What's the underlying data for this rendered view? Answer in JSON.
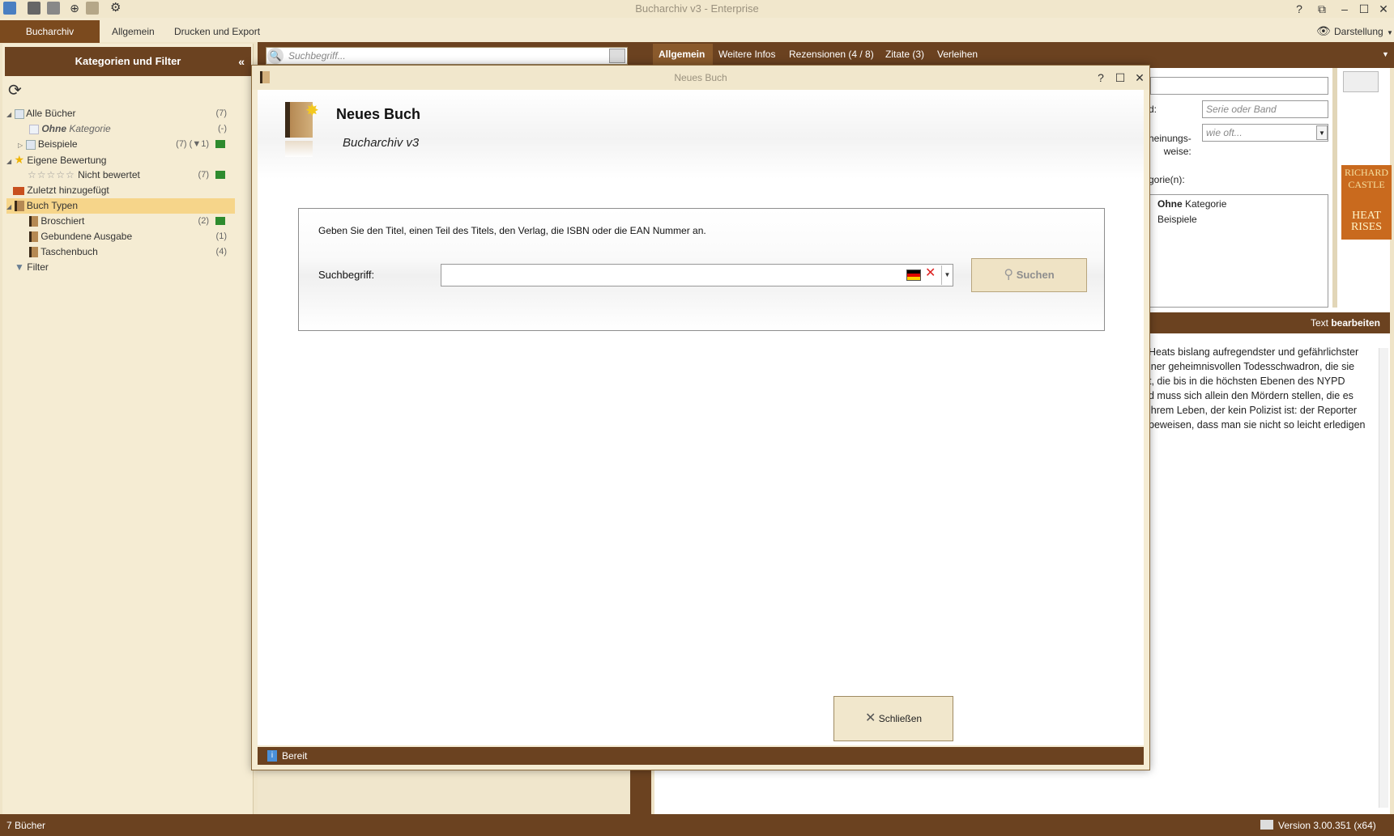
{
  "app": {
    "title": "Bucharchiv v3 - Enterprise",
    "window_controls": [
      "?",
      "⧉",
      "–",
      "☐",
      "✕"
    ],
    "ribbon_active_tab": "Bucharchiv",
    "ribbon_tabs": [
      "Allgemein",
      "Drucken und Export"
    ],
    "darstellung": "Darstellung"
  },
  "sidebar": {
    "header": "Kategorien und Filter",
    "collapse": "«",
    "tree": [
      {
        "label": "Alle Bücher",
        "count": "(7)"
      },
      {
        "label_bold": "Ohne",
        "label": " Kategorie",
        "count": "(-)"
      },
      {
        "label": "Beispiele",
        "count": "(7) (▼1)"
      },
      {
        "label": "Eigene Bewertung",
        "count": ""
      },
      {
        "label": "Nicht bewertet",
        "count": "(7)"
      },
      {
        "label": "Zuletzt hinzugefügt",
        "count": ""
      },
      {
        "label": "Buch Typen",
        "count": ""
      },
      {
        "label": "Broschiert",
        "count": "(2)"
      },
      {
        "label": "Gebundene Ausgabe",
        "count": "(1)"
      },
      {
        "label": "Taschenbuch",
        "count": "(4)"
      },
      {
        "label": "Filter",
        "count": ""
      }
    ]
  },
  "mid": {
    "search_placeholder": "Suchbegriff..."
  },
  "detail": {
    "tabs": [
      "Allgemein",
      "Weitere Infos",
      "Rezensionen (4 / 8)",
      "Zitate (3)",
      "Verleihen"
    ],
    "fields": {
      "band_label": "d:",
      "band_placeholder": "Serie oder Band",
      "erscheinung_label": "heinungs-\nweise:",
      "erscheinung_value": "wie oft...",
      "kategorie_label": "gorie(n):"
    },
    "categories": [
      {
        "bold": "Ohne",
        "rest": " Kategorie"
      },
      {
        "bold": "",
        "rest": "Beispiele"
      }
    ],
    "text_label": "Text ",
    "text_label_bold": "bearbeiten",
    "description": [
      "Heats bislang aufregendster und gefährlichster",
      "iner geheimnisvollen Todesschwadron, die sie",
      "t, die bis in die höchsten Ebenen des NYPD",
      "d muss sich allein den Mördern stellen, die es",
      "ihrem Leben, der kein Polizist ist: der Reporter",
      "beweisen, dass man sie nicht so leicht erledigen"
    ],
    "cover": {
      "author": "RICHARD CASTLE",
      "title": "HEAT RISES"
    }
  },
  "status": {
    "left": "7 Bücher",
    "right": "Version 3.00.351 (x64)"
  },
  "dialog": {
    "window_title": "Neues Buch",
    "heading": "Neues Buch",
    "subheading": "Bucharchiv v3",
    "hint": "Geben Sie den Titel, einen Teil des Titels, den Verlag, die ISBN oder die EAN Nummer an.",
    "search_label": "Suchbegriff:",
    "search_value": "",
    "search_button": "Suchen",
    "close_button": "Schließen",
    "status": "Bereit",
    "controls": [
      "?",
      "☐",
      "✕"
    ]
  }
}
